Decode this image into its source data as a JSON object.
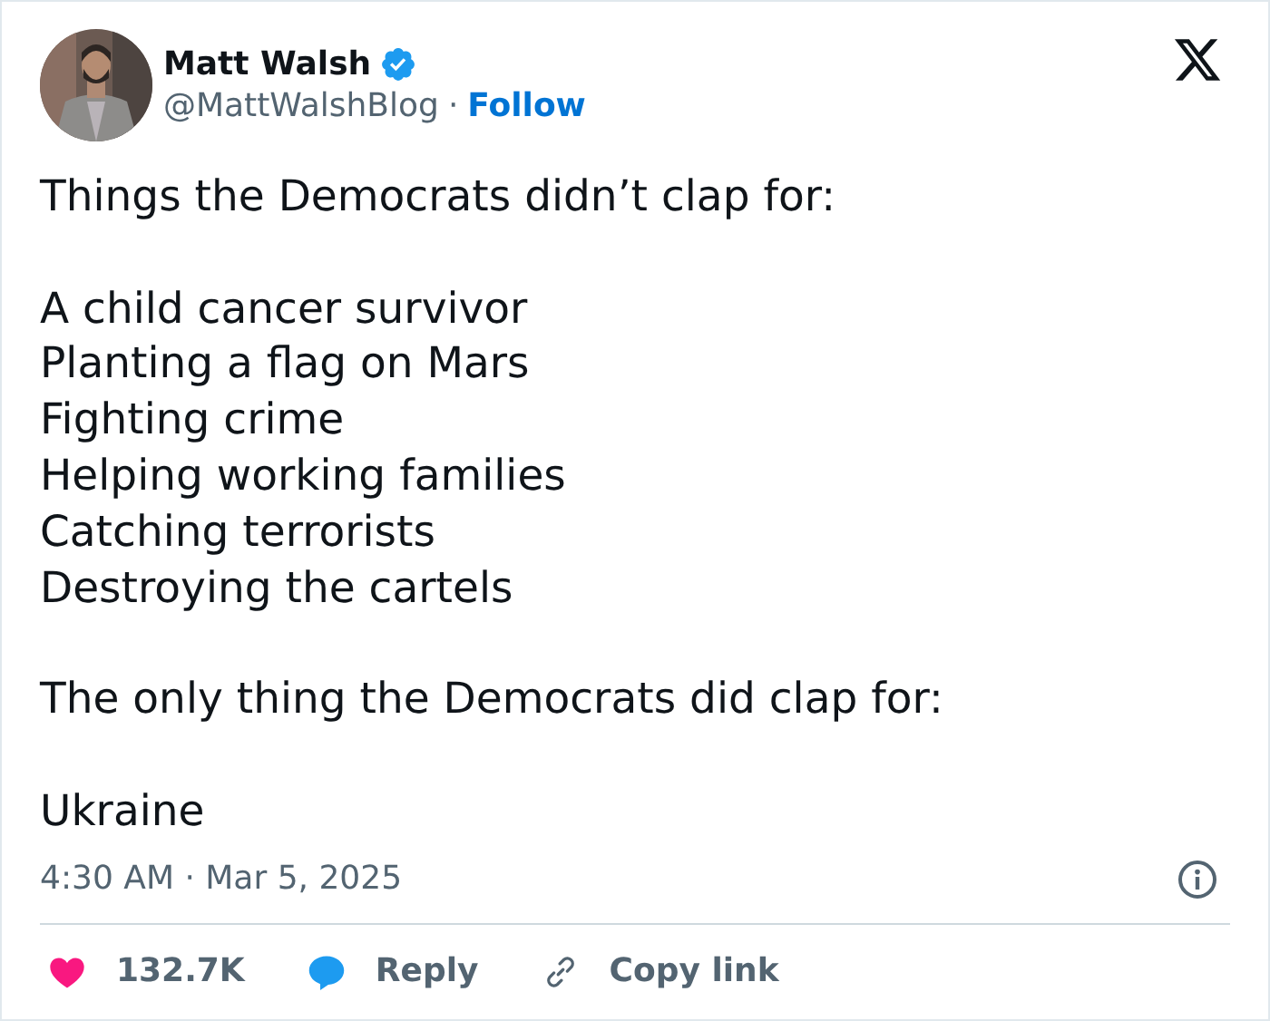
{
  "author": {
    "name": "Matt Walsh",
    "verified": true,
    "handle": "@MattWalshBlog",
    "separator": "·",
    "follow": "Follow"
  },
  "paragraphs": [
    "Things the Democrats didn’t clap for:",
    "A child cancer survivor\nPlanting a flag on Mars\nFighting crime\nHelping working families\nCatching terrorists\nDestroying the cartels",
    "The only thing the Democrats did clap for:",
    "Ukraine"
  ],
  "timestamp": "4:30 AM · Mar 5, 2025",
  "actions": [
    {
      "kind": "like",
      "label": "132.7K"
    },
    {
      "kind": "reply",
      "label": "Reply"
    },
    {
      "kind": "copy",
      "label": "Copy link"
    }
  ]
}
